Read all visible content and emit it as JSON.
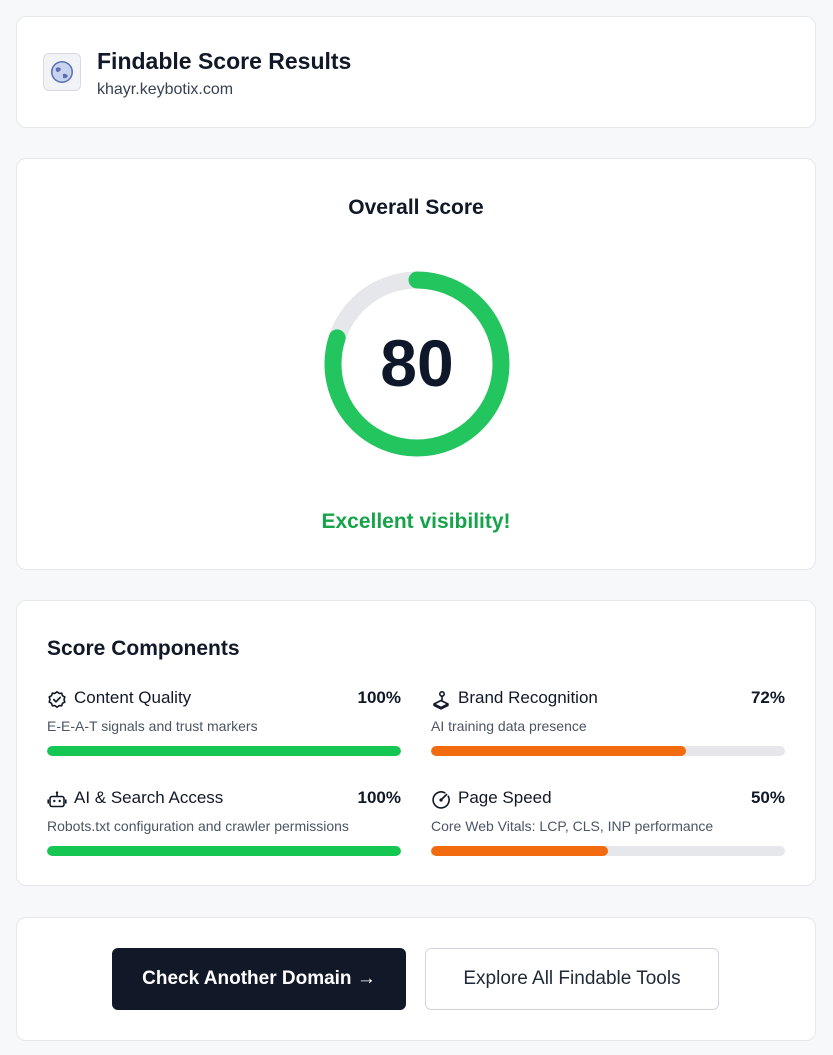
{
  "header": {
    "title": "Findable Score Results",
    "domain": "khayr.keybotix.com",
    "icon": "globe-icon"
  },
  "overall": {
    "heading": "Overall Score",
    "score": "80",
    "score_fraction": 0.8,
    "verdict": "Excellent visibility!",
    "ring_color": "#22c55e",
    "track_color": "#e5e7eb",
    "verdict_color": "#16a34a"
  },
  "components": {
    "heading": "Score Components",
    "items": [
      {
        "icon": "check-badge-icon",
        "name": "Content Quality",
        "percent": "100%",
        "value": 1.0,
        "description": "E-E-A-T signals and trust markers",
        "color": "#16c653"
      },
      {
        "icon": "brand-icon",
        "name": "Brand Recognition",
        "percent": "72%",
        "value": 0.72,
        "description": "AI training data presence",
        "color": "#f26b0f"
      },
      {
        "icon": "robot-icon",
        "name": "AI & Search Access",
        "percent": "100%",
        "value": 1.0,
        "description": "Robots.txt configuration and crawler permissions",
        "color": "#16c653"
      },
      {
        "icon": "gauge-icon",
        "name": "Page Speed",
        "percent": "50%",
        "value": 0.5,
        "description": "Core Web Vitals: LCP, CLS, INP performance",
        "color": "#f26b0f"
      }
    ]
  },
  "actions": {
    "primary_label": "Check Another Domain →",
    "secondary_label": "Explore All Findable Tools"
  }
}
